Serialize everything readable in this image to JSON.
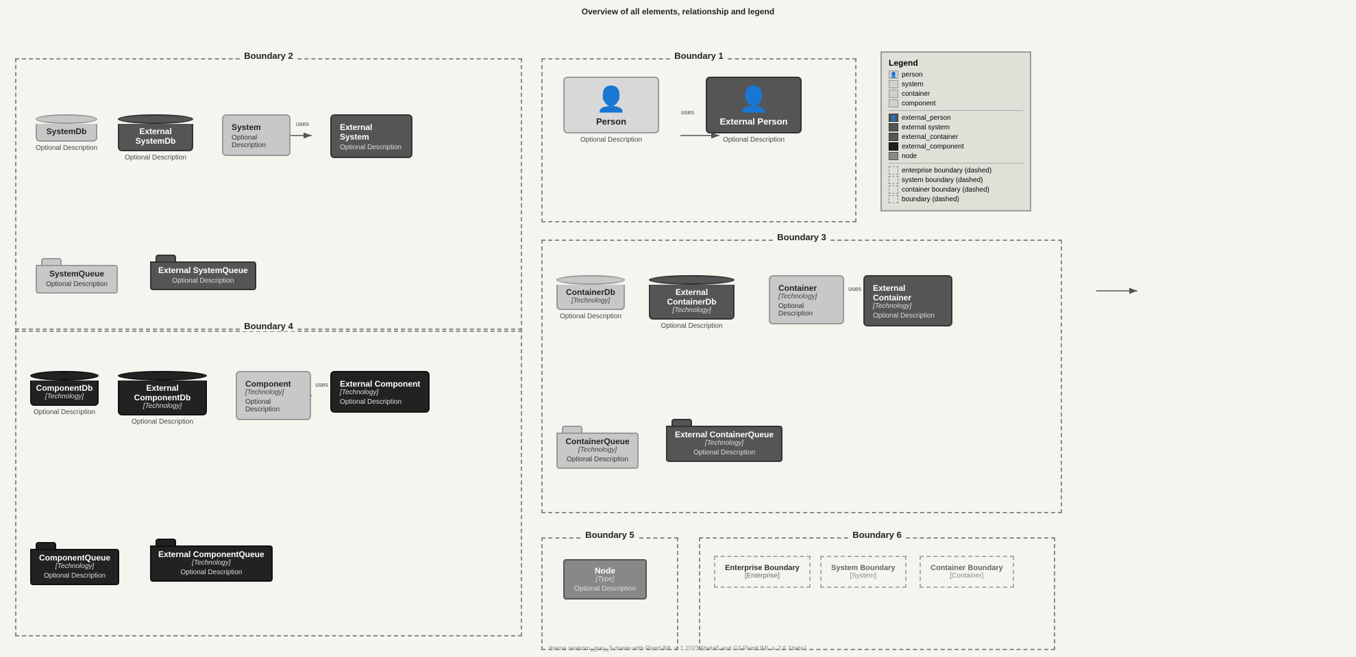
{
  "page": {
    "title": "Overview of all elements, relationship and legend",
    "footer": "theme seaborn_gray_9 drawn with PlantUML v. 1.2023.6beta5 and C4-PlantUML v. 2.6.1beta1"
  },
  "boundary2": {
    "label": "Boundary 2",
    "elements": {
      "systemDb": {
        "title": "SystemDb",
        "desc": "Optional Description"
      },
      "externalSystemDb": {
        "title": "External SystemDb",
        "desc": "Optional Description"
      },
      "system": {
        "title": "System",
        "desc": "Optional Description"
      },
      "externalSystem": {
        "title": "External System",
        "desc": "Optional Description"
      },
      "systemQueue": {
        "title": "SystemQueue",
        "desc": "Optional Description"
      },
      "externalSystemQueue": {
        "title": "External SystemQueue",
        "desc": "Optional Description"
      }
    },
    "arrows": [
      {
        "from": "system",
        "to": "externalSystem",
        "label": "uses"
      }
    ]
  },
  "boundary1": {
    "label": "Boundary 1",
    "elements": {
      "person": {
        "title": "Person",
        "desc": "Optional Description"
      },
      "externalPerson": {
        "title": "External Person",
        "desc": "Optional Description"
      }
    },
    "arrows": [
      {
        "from": "person",
        "to": "externalPerson",
        "label": "uses"
      }
    ]
  },
  "boundary3": {
    "label": "Boundary 3",
    "elements": {
      "containerDb": {
        "title": "ContainerDb",
        "tech": "[Technology]",
        "desc": "Optional Description"
      },
      "externalContainerDb": {
        "title": "External ContainerDb",
        "tech": "[Technology]",
        "desc": "Optional Description"
      },
      "container": {
        "title": "Container",
        "tech": "[Technology]",
        "desc": "Optional Description"
      },
      "externalContainer": {
        "title": "External Container",
        "tech": "[Technology]",
        "desc": "Optional Description"
      },
      "containerQueue": {
        "title": "ContainerQueue",
        "tech": "[Technology]",
        "desc": "Optional Description"
      },
      "externalContainerQueue": {
        "title": "External ContainerQueue",
        "tech": "[Technology]",
        "desc": "Optional Description"
      }
    },
    "arrows": [
      {
        "from": "container",
        "to": "externalContainer",
        "label": "uses"
      }
    ]
  },
  "boundary4": {
    "label": "Boundary 4",
    "elements": {
      "componentDb": {
        "title": "ComponentDb",
        "tech": "[Technology]",
        "desc": "Optional Description"
      },
      "externalComponentDb": {
        "title": "External ComponentDb",
        "tech": "[Technology]",
        "desc": "Optional Description"
      },
      "component": {
        "title": "Component",
        "tech": "[Technology]",
        "desc": "Optional Description"
      },
      "externalComponent": {
        "title": "External Component",
        "tech": "[Technology]",
        "desc": "Optional Description"
      },
      "componentQueue": {
        "title": "ComponentQueue",
        "tech": "[Technology]",
        "desc": "Optional Description"
      },
      "externalComponentQueue": {
        "title": "External ComponentQueue",
        "tech": "[Technology]",
        "desc": "Optional Description"
      }
    },
    "arrows": [
      {
        "from": "component",
        "to": "externalComponent",
        "label": "uses"
      }
    ]
  },
  "boundary5": {
    "label": "Boundary 5",
    "elements": {
      "node": {
        "title": "Node",
        "tech": "[Type]",
        "desc": "Optional Description"
      }
    }
  },
  "boundary6": {
    "label": "Boundary 6",
    "elements": {
      "enterpriseBoundary": {
        "title": "Enterprise Boundary",
        "sub": "[Enterprise]"
      },
      "systemBoundary": {
        "title": "System Boundary",
        "sub": "[System]"
      },
      "containerBoundary": {
        "title": "Container Boundary",
        "sub": "[Container]"
      }
    }
  },
  "legend": {
    "title": "Legend",
    "items": [
      {
        "type": "person",
        "label": "person",
        "color": "light"
      },
      {
        "type": "system",
        "label": "system",
        "color": "light"
      },
      {
        "type": "container",
        "label": "container",
        "color": "light"
      },
      {
        "type": "component",
        "label": "component",
        "color": "light"
      },
      {
        "type": "external_person",
        "label": "external_person",
        "color": "dark"
      },
      {
        "type": "external_system",
        "label": "external system",
        "color": "dark"
      },
      {
        "type": "external_container",
        "label": "external_container",
        "color": "dark"
      },
      {
        "type": "external_component",
        "label": "external_component",
        "color": "darkest"
      },
      {
        "type": "node",
        "label": "node",
        "color": "medium"
      }
    ],
    "boundaries": [
      {
        "label": "enterprise boundary (dashed)"
      },
      {
        "label": "system boundary (dashed)"
      },
      {
        "label": "container boundary (dashed)"
      },
      {
        "label": "boundary (dashed)"
      }
    ]
  }
}
